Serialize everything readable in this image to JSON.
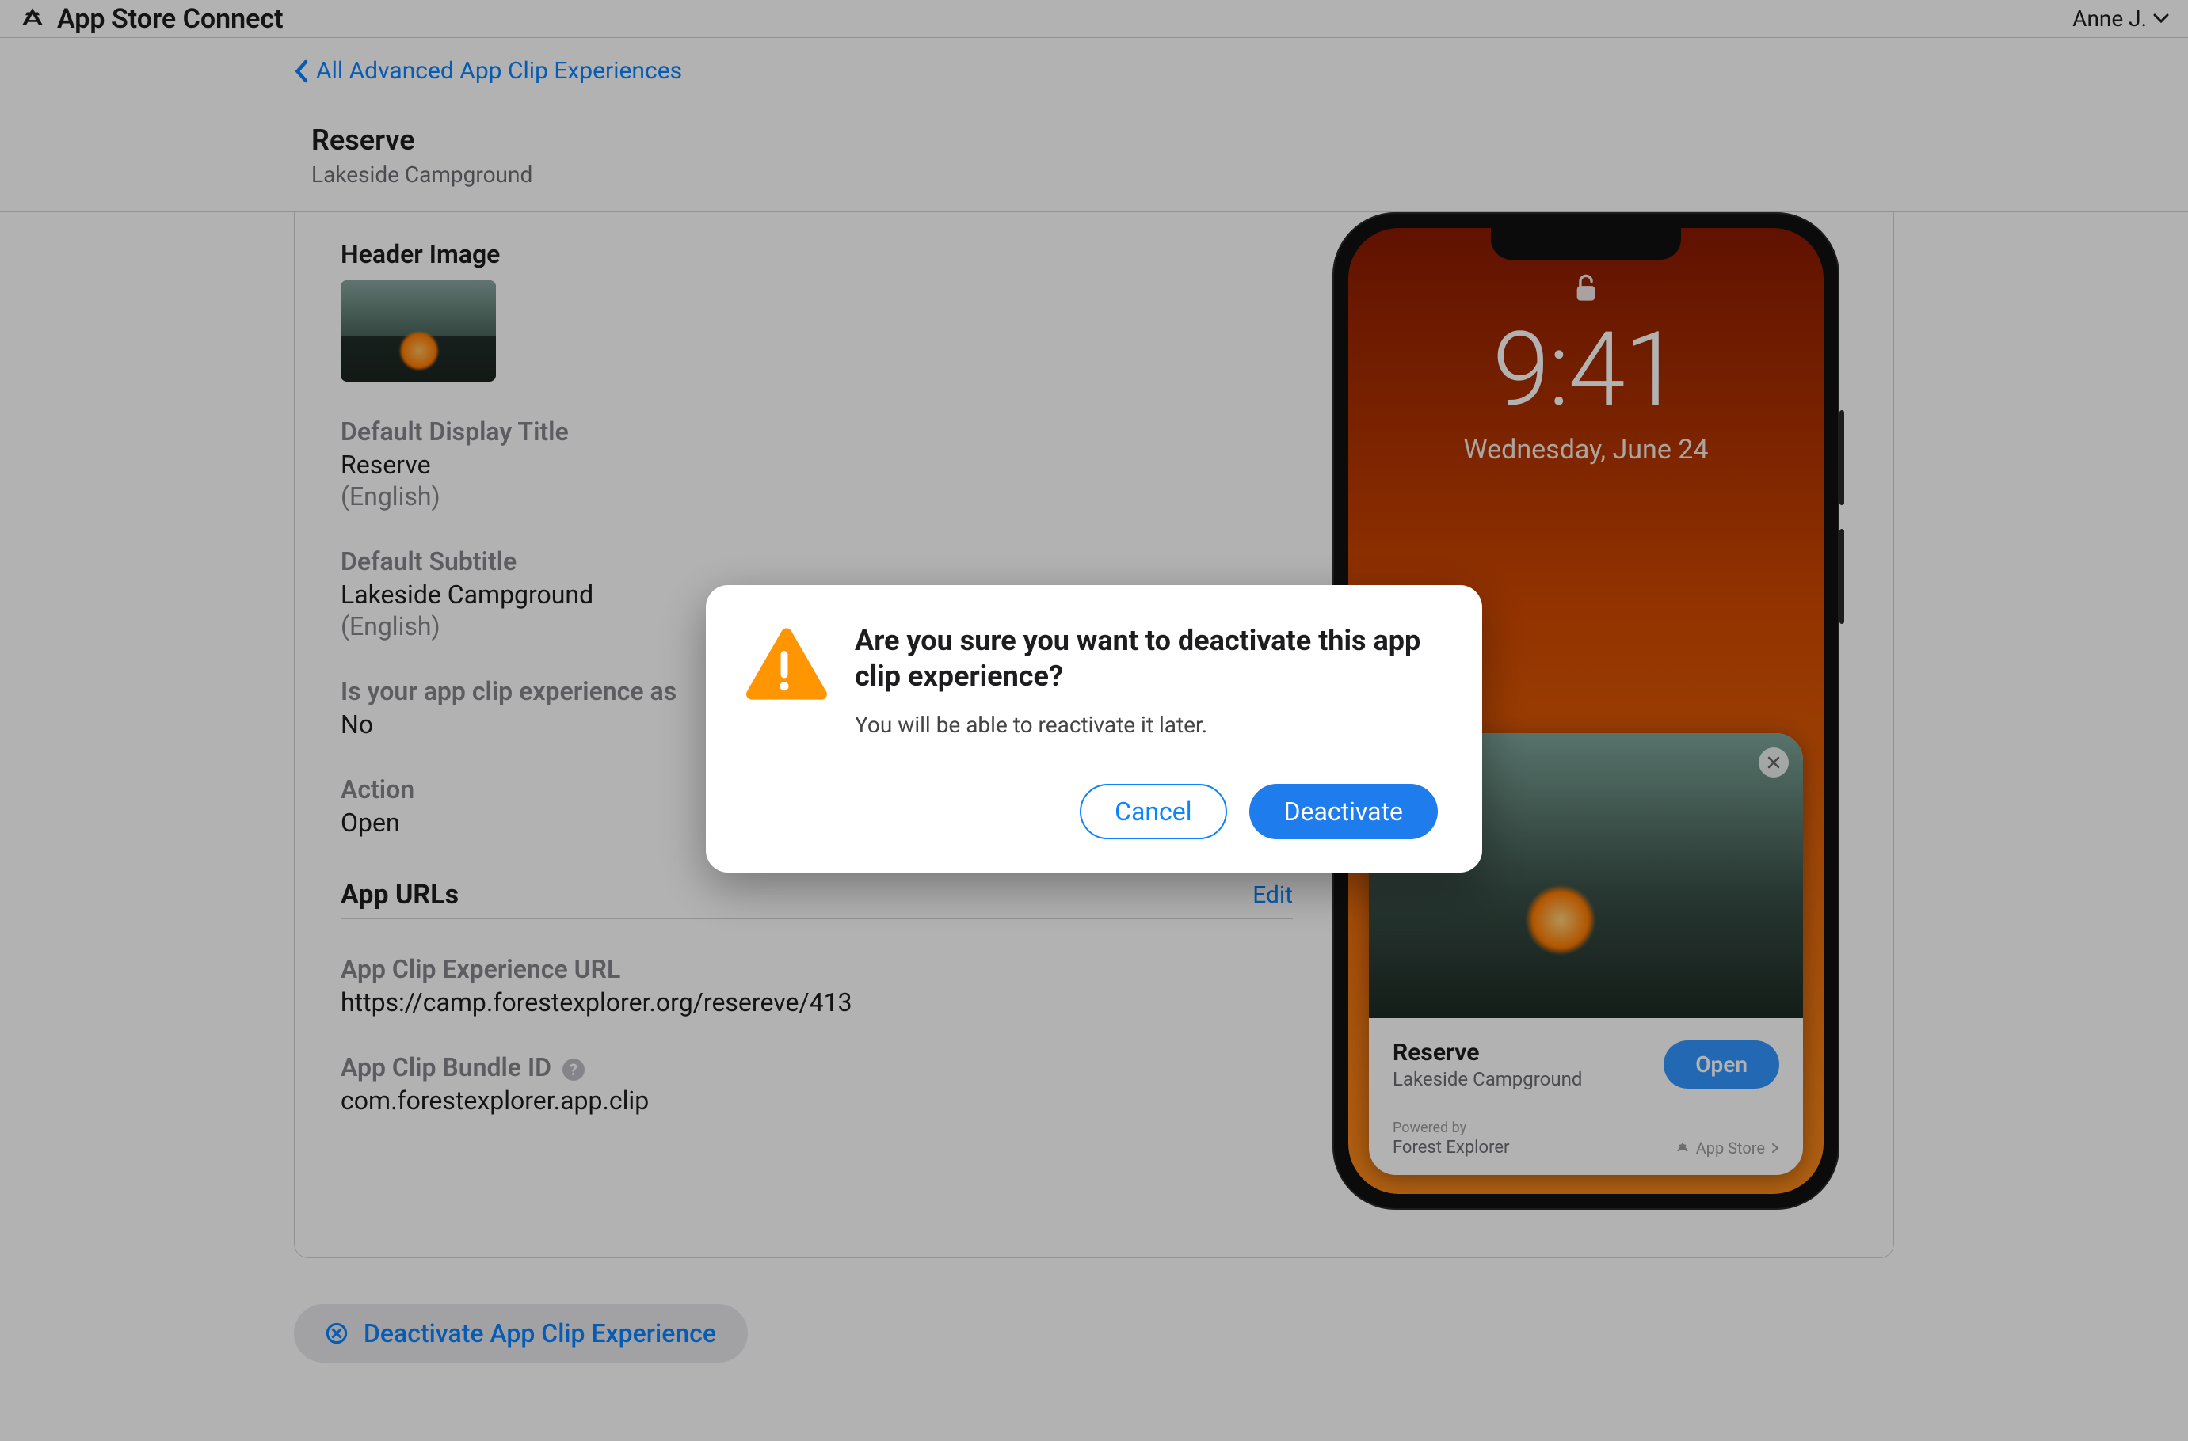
{
  "header": {
    "brand": "App Store Connect",
    "user_name": "Anne J."
  },
  "nav": {
    "back_label": "All Advanced App Clip Experiences"
  },
  "page": {
    "title": "Reserve",
    "subtitle": "Lakeside Campground"
  },
  "details": {
    "header_image_label": "Header Image",
    "display_title_label": "Default Display Title",
    "display_title_value": "Reserve",
    "display_title_lang": "(English)",
    "subtitle_label": "Default Subtitle",
    "subtitle_value": "Lakeside Campground",
    "subtitle_lang": "(English)",
    "associated_label": "Is your app clip experience as",
    "associated_value": "No",
    "action_label": "Action",
    "action_value": "Open"
  },
  "urls": {
    "heading": "App URLs",
    "edit_label": "Edit",
    "experience_url_label": "App Clip Experience URL",
    "experience_url_value": "https://camp.forestexplorer.org/resereve/413",
    "bundle_id_label": "App Clip Bundle ID",
    "bundle_id_value": "com.forestexplorer.app.clip"
  },
  "deactivate_button_label": "Deactivate App Clip Experience",
  "phone": {
    "time": "9:41",
    "date": "Wednesday, June 24",
    "clip_title": "Reserve",
    "clip_subtitle": "Lakeside Campground",
    "open_label": "Open",
    "powered_by_label": "Powered by",
    "powered_by_value": "Forest Explorer",
    "store_label": "App Store"
  },
  "modal": {
    "title": "Are you sure you want to deactivate this app clip experience?",
    "message": "You will be able to reactivate it later.",
    "cancel_label": "Cancel",
    "confirm_label": "Deactivate"
  }
}
